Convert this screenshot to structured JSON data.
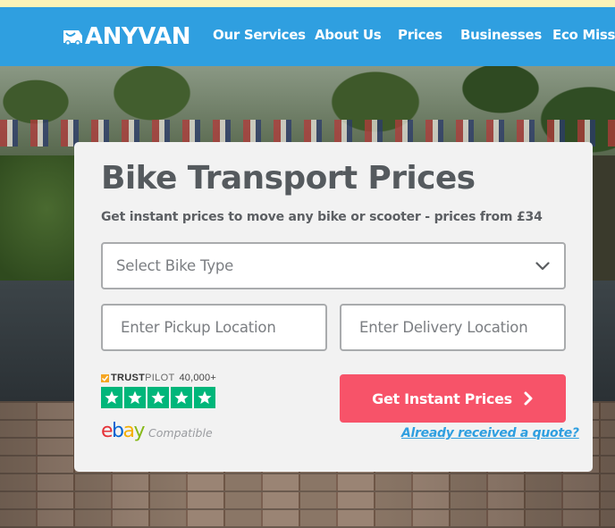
{
  "header": {
    "logo_text": "ANYVAN",
    "nav": [
      "Our Services",
      "About Us",
      "Prices",
      "Businesses",
      "Eco Missio"
    ]
  },
  "form": {
    "title": "Bike Transport Prices",
    "subtitle": "Get instant prices to move any bike or scooter - prices from £34",
    "bike_type": {
      "value": "Select Bike Type"
    },
    "pickup": {
      "placeholder": "Enter Pickup Location"
    },
    "delivery": {
      "placeholder": "Enter Delivery Location"
    },
    "submit_label": "Get Instant Prices",
    "quote_link": "Already received a quote?"
  },
  "badges": {
    "trustpilot": {
      "brand_bold": "TRUST",
      "brand_light": "PILOT",
      "count": "40,000+",
      "stars": 5
    },
    "ebay": {
      "letters": [
        "e",
        "b",
        "a",
        "y"
      ],
      "compatible_label": "Compatible"
    }
  },
  "colors": {
    "nav_bg": "#2f9fe0",
    "cta": "#f75369",
    "trustpilot_green": "#00b67a",
    "link": "#2f9fe0"
  }
}
